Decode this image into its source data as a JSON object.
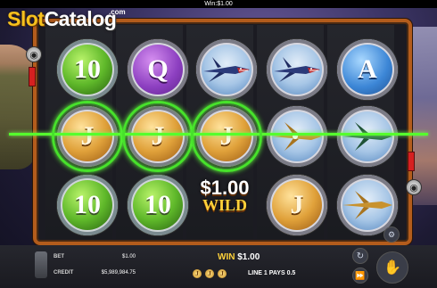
{
  "topbar": {
    "win_label": "Win:$1.00"
  },
  "logo": {
    "part1": "Slot",
    "part2": "Catalog",
    "suffix": ".com"
  },
  "reels": [
    [
      "10",
      "J",
      "10"
    ],
    [
      "Q",
      "J",
      "10"
    ],
    [
      "plane-shark",
      "J",
      "WILD"
    ],
    [
      "plane-shark",
      "plane-gold",
      "J"
    ],
    [
      "A",
      "plane-green",
      "plane-gold"
    ]
  ],
  "wild": {
    "amount": "$1.00",
    "word": "WILD"
  },
  "status": {
    "bet_label": "BET",
    "bet_value": "$1.00",
    "credit_label": "CREDIT",
    "credit_value": "$5,989,984.75",
    "win_label": "WIN",
    "win_value": "$1.00",
    "line_text": "LINE 1 PAYS 0.5",
    "mini_coins": [
      "J",
      "J",
      "J"
    ]
  },
  "colors": {
    "winline": "#55ff2d",
    "frame": "#b35c1c",
    "gold": "#ffd23a"
  },
  "icons": [
    "settings-icon",
    "autoplay-icon",
    "fastforward-icon",
    "spin-icon",
    "coins-icon"
  ]
}
